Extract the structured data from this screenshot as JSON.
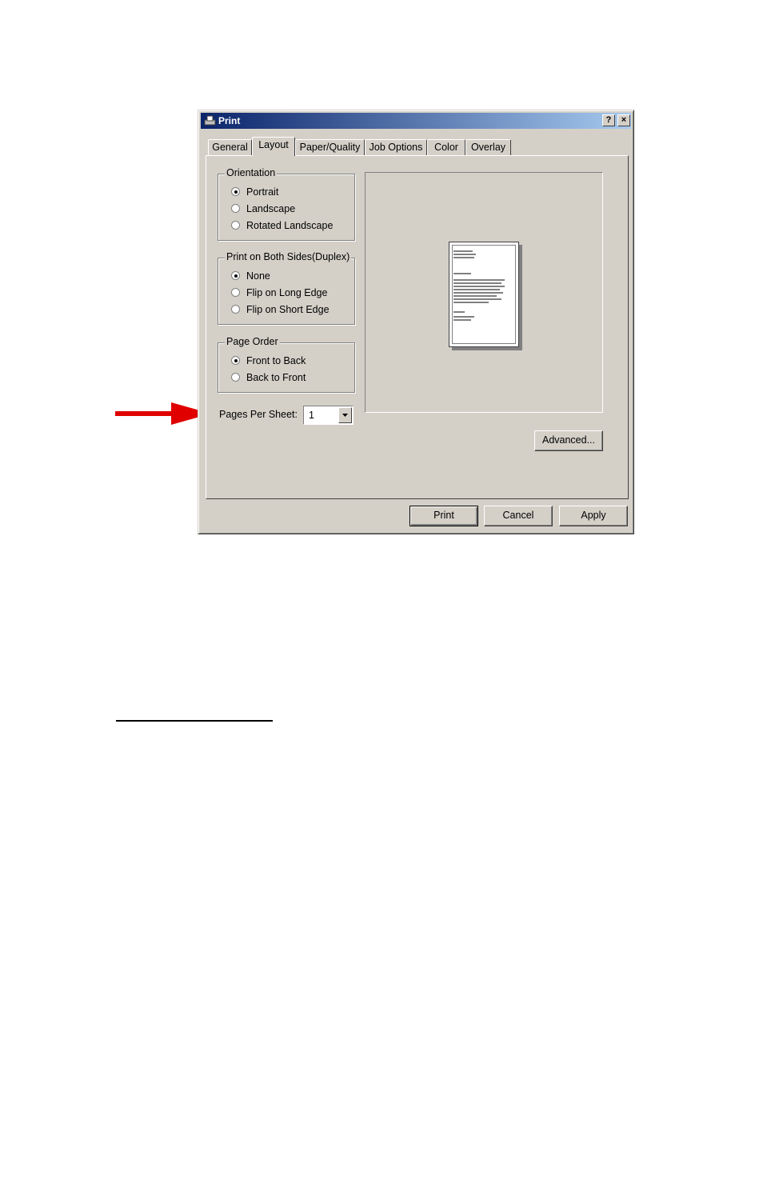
{
  "window": {
    "title": "Print",
    "help_label": "?",
    "close_label": "×"
  },
  "tabs": [
    {
      "label": "General"
    },
    {
      "label": "Layout"
    },
    {
      "label": "Paper/Quality"
    },
    {
      "label": "Job Options"
    },
    {
      "label": "Color"
    },
    {
      "label": "Overlay"
    }
  ],
  "orientation": {
    "label": "Orientation",
    "options": [
      "Portrait",
      "Landscape",
      "Rotated Landscape"
    ],
    "selected": "Portrait"
  },
  "duplex": {
    "label": "Print on Both Sides(Duplex)",
    "options": [
      "None",
      "Flip on Long Edge",
      "Flip on Short Edge"
    ],
    "selected": "None"
  },
  "page_order": {
    "label": "Page Order",
    "options": [
      "Front to Back",
      "Back to Front"
    ],
    "selected": "Front to Back"
  },
  "pages_per_sheet": {
    "label": "Pages Per Sheet:",
    "value": "1"
  },
  "buttons": {
    "advanced": "Advanced...",
    "print": "Print",
    "cancel": "Cancel",
    "apply": "Apply"
  },
  "annotation": {
    "arrow_color": "#e00000"
  }
}
